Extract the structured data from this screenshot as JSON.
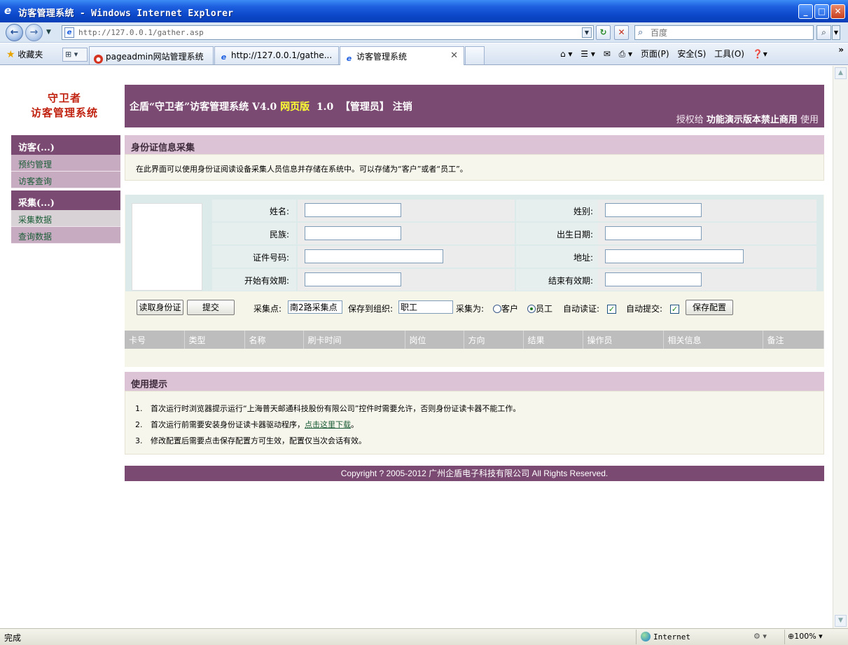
{
  "window": {
    "title": "访客管理系统 - Windows Internet Explorer",
    "minimize": "_",
    "maximize": "□",
    "close": "✕"
  },
  "browser": {
    "back_icon": "back-arrow-icon",
    "forward_icon": "forward-arrow-icon",
    "address": "http://127.0.0.1/gather.asp",
    "search_placeholder": "百度",
    "favorites_label": "收藏夹",
    "tabs": [
      {
        "label": "pageadmin网站管理系统",
        "icon": "pageadmin-icon"
      },
      {
        "label": "http://127.0.0.1/gathe...",
        "icon": "ie-icon"
      },
      {
        "label": "访客管理系统",
        "icon": "ie-icon",
        "active": true
      }
    ],
    "commands": {
      "page": "页面(P)",
      "safety": "安全(S)",
      "tools": "工具(O)"
    },
    "status": {
      "text": "完成",
      "zone": "Internet",
      "zoom": "100%"
    }
  },
  "logo": {
    "line1": "守卫者",
    "line2": "访客管理系统"
  },
  "header": {
    "title_prefix": "企盾“守卫者”访客管理系统 V4.0 ",
    "web_edition": "网页版",
    "title_suffix": "  1.0  【管理员】 注销",
    "license_prefix": "授权给 ",
    "license_name": "功能演示版本禁止商用",
    "license_suffix": " 使用"
  },
  "sidebar": {
    "groups": [
      {
        "title": "访客(...)",
        "items": [
          "预约管理",
          "访客查询"
        ]
      },
      {
        "title": "采集(...)",
        "items": [
          "采集数据",
          "查询数据"
        ]
      }
    ]
  },
  "collect": {
    "section_title": "身份证信息采集",
    "description": "在此界面可以使用身份证阅读设备采集人员信息并存储在系统中。可以存储为“客户”或者“员工”。",
    "fields": {
      "name_label": "姓名:",
      "gender_label": "姓别:",
      "ethnicity_label": "民族:",
      "birth_label": "出生日期:",
      "id_label": "证件号码:",
      "address_label": "地址:",
      "valid_from_label": "开始有效期:",
      "valid_to_label": "结束有效期:"
    },
    "controls": {
      "read_id_button": "读取身份证",
      "submit_button": "提交",
      "point_label": "采集点:",
      "point_value": "南2路采集点",
      "org_label": "保存到组织:",
      "org_value": "职工",
      "collect_as_label": "采集为:",
      "customer_option": "客户",
      "employee_option": "员工",
      "selected": "员工",
      "auto_read_label": "自动读证:",
      "auto_read": true,
      "auto_submit_label": "自动提交:",
      "auto_submit": true,
      "save_config_button": "保存配置"
    },
    "table_headers": [
      "卡号",
      "类型",
      "名称",
      "刷卡时间",
      "岗位",
      "方向",
      "结果",
      "操作员",
      "相关信息",
      "备注"
    ]
  },
  "tips": {
    "title": "使用提示",
    "items": [
      {
        "num": "1.",
        "text": "首次运行时浏览器提示运行“上海普天邮通科技股份有限公司”控件时需要允许，否则身份证读卡器不能工作。"
      },
      {
        "num": "2.",
        "text": "首次运行前需要安装身份证读卡器驱动程序，",
        "link": "点击这里下载",
        "after": "。"
      },
      {
        "num": "3.",
        "text": "修改配置后需要点击保存配置方可生效，配置仅当次会话有效。"
      }
    ]
  },
  "footer": {
    "copyright": "Copyright ? 2005-2012 广州企盾电子科技有限公司   All Rights Reserved."
  }
}
